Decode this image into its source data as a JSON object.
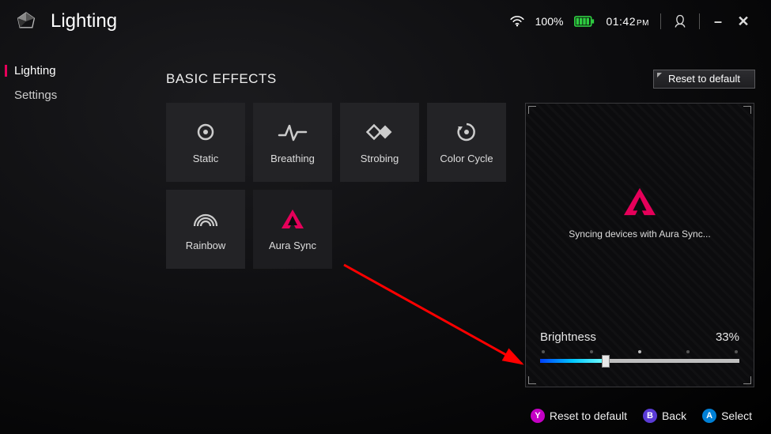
{
  "header": {
    "title": "Lighting",
    "battery_pct": "100%",
    "clock_time": "01:42",
    "clock_suffix": "PM"
  },
  "sidebar": {
    "items": [
      {
        "label": "Lighting",
        "active": true
      },
      {
        "label": "Settings",
        "active": false
      }
    ]
  },
  "section": {
    "title": "BASIC EFFECTS",
    "reset_label": "Reset to default"
  },
  "effects": [
    {
      "id": "static",
      "label": "Static"
    },
    {
      "id": "breathing",
      "label": "Breathing"
    },
    {
      "id": "strobing",
      "label": "Strobing"
    },
    {
      "id": "colorcycle",
      "label": "Color Cycle"
    },
    {
      "id": "rainbow",
      "label": "Rainbow"
    },
    {
      "id": "aurasync",
      "label": "Aura Sync",
      "selected": true
    }
  ],
  "preview": {
    "message": "Syncing devices with Aura Sync...",
    "brightness_label": "Brightness",
    "brightness_value": "33%",
    "brightness_pct": 33
  },
  "footer": {
    "y_label": "Reset to default",
    "b_label": "Back",
    "a_label": "Select"
  },
  "colors": {
    "accent": "#e6005a"
  }
}
